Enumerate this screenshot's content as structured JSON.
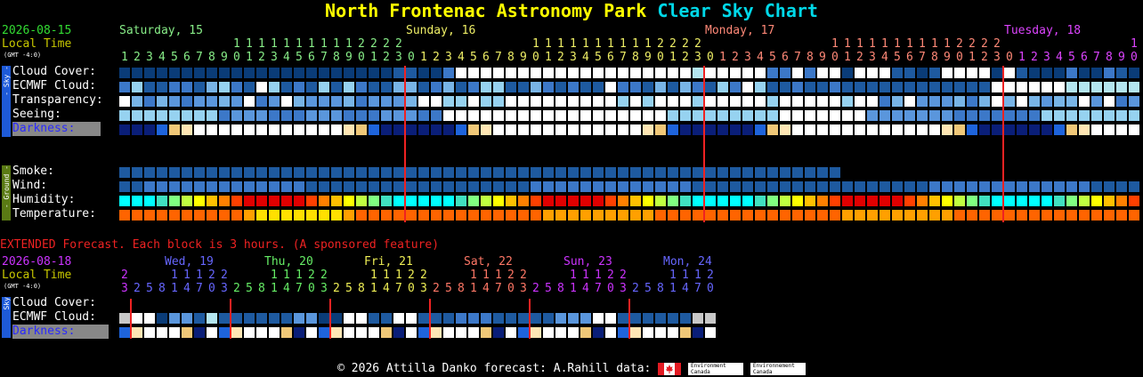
{
  "title": {
    "park": "North Frontenac Astronomy Park",
    "clear": "Clear",
    "sky": "Sky",
    "chart": "Chart"
  },
  "main": {
    "date": "2026-08-15",
    "local_time_label": "Local Time",
    "gmt_label": "(GMT -4:0)",
    "days": [
      {
        "label": "Saturday, 15",
        "color": "#88ee88"
      },
      {
        "label": "Sunday, 16",
        "color": "#eeee66"
      },
      {
        "label": "Monday, 17",
        "color": "#ff8877"
      },
      {
        "label": "Tuesday, 18",
        "color": "#dd44ff"
      }
    ],
    "hour_tens_row": "1 1 1 1 1 1 1 1 1 1 2 2 2 2",
    "hour_units_row": "1 2 3 4 5 6 7 8 9 0 1 2 3 4 5 6 7 8 9 0 1 2 3",
    "sky_tag": "- Sky -",
    "ground_tag": "- Ground -",
    "rows": {
      "cloud": "Cloud Cover:",
      "ecmwf": "ECMWF Cloud:",
      "transparency": "Transparency:",
      "seeing": "Seeing:",
      "darkness": "Darkness:",
      "smoke": "Smoke:",
      "wind": "Wind:",
      "humidity": "Humidity:",
      "temperature": "Temperature:"
    }
  },
  "extended": {
    "heading": "EXTENDED Forecast. Each block is 3 hours. (A sponsored feature)",
    "date": "2026-08-18",
    "local_time_label": "Local Time",
    "gmt_label": "(GMT -4:0)",
    "days": [
      {
        "label": "Wed, 19",
        "color": "#6666ff"
      },
      {
        "label": "Thu, 20",
        "color": "#66ee66"
      },
      {
        "label": "Fri, 21",
        "color": "#eeee55"
      },
      {
        "label": "Sat, 22",
        "color": "#ff7766"
      },
      {
        "label": "Sun, 23",
        "color": "#cc33ff"
      },
      {
        "label": "Mon, 24",
        "color": "#6666ff"
      }
    ],
    "tens_first": "2",
    "tens_row": "1 1 1 2 2",
    "tens_last": "1 1 1 2",
    "units_row": "3 2 5 8 1 4 7 0 3 2 5 8 1 4 7 0 3 2 5 8 1 4 7 0 3 2 5 8 1 4 7 0 3 2 5 8 1 4 7 0 3 2 5 8 1 4 7 0",
    "rows": {
      "cloud": "Cloud Cover:",
      "ecmwf": "ECMWF Cloud:",
      "darkness": "Darkness:"
    },
    "sky_tag": "Sky"
  },
  "footer": {
    "copyright": "© 2026 Attilla Danko",
    "forecast": "forecast: A.Rahill",
    "data": "data:",
    "ec_en": "Environment Canada",
    "ec_fr": "Environnement Canada"
  },
  "colors": {
    "title_yellow": "#ffff00",
    "title_cyan": "#00d8e8",
    "midnight_line": "#ee2222",
    "clear_dark_blue": "#0a3c78",
    "cloud_white": "#ffffff"
  }
}
